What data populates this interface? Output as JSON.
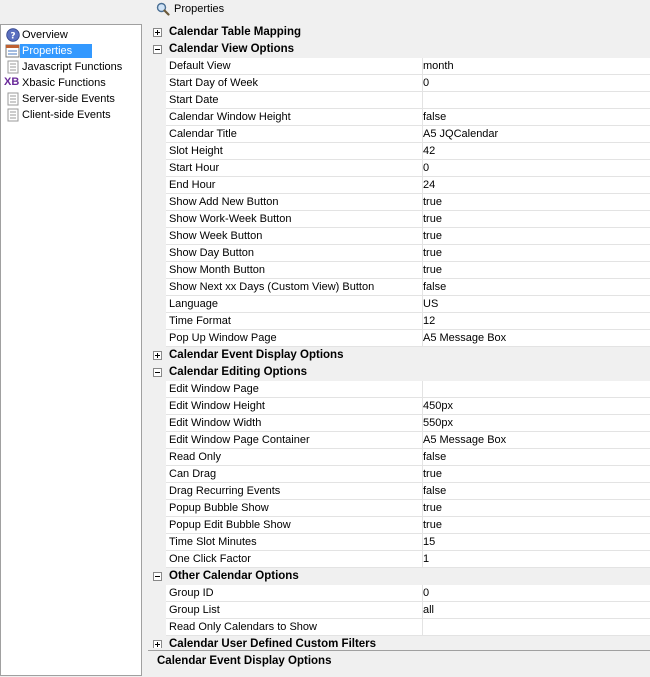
{
  "header": {
    "title": "Properties",
    "icon": "search-icon"
  },
  "sidebar": {
    "items": [
      {
        "label": "Overview",
        "icon": "overview-icon",
        "selected": false
      },
      {
        "label": "Properties",
        "icon": "properties-icon",
        "selected": true
      },
      {
        "label": "Javascript Functions",
        "icon": "javascript-icon",
        "selected": false
      },
      {
        "label": "Xbasic Functions",
        "icon": "xbasic-icon",
        "icon_text": "XB",
        "selected": false
      },
      {
        "label": "Server-side Events",
        "icon": "server-events-icon",
        "selected": false
      },
      {
        "label": "Client-side Events",
        "icon": "client-events-icon",
        "selected": false
      }
    ]
  },
  "grid": {
    "rows": [
      {
        "type": "category",
        "label": "Calendar Table Mapping",
        "expanded": false
      },
      {
        "type": "category",
        "label": "Calendar View Options",
        "expanded": true
      },
      {
        "type": "prop",
        "name": "Default View",
        "value": "month"
      },
      {
        "type": "prop",
        "name": "Start Day of Week",
        "value": "0"
      },
      {
        "type": "prop",
        "name": "Start Date",
        "value": ""
      },
      {
        "type": "prop",
        "name": "Calendar Window Height",
        "value": "false"
      },
      {
        "type": "prop",
        "name": "Calendar Title",
        "value": "A5 JQCalendar"
      },
      {
        "type": "prop",
        "name": "Slot Height",
        "value": "42"
      },
      {
        "type": "prop",
        "name": "Start Hour",
        "value": "0"
      },
      {
        "type": "prop",
        "name": "End Hour",
        "value": "24"
      },
      {
        "type": "prop",
        "name": "Show Add New Button",
        "value": "true"
      },
      {
        "type": "prop",
        "name": "Show Work-Week Button",
        "value": "true"
      },
      {
        "type": "prop",
        "name": "Show Week Button",
        "value": "true"
      },
      {
        "type": "prop",
        "name": "Show Day Button",
        "value": "true"
      },
      {
        "type": "prop",
        "name": "Show Month Button",
        "value": "true"
      },
      {
        "type": "prop",
        "name": "Show Next xx Days (Custom View) Button",
        "value": "false"
      },
      {
        "type": "prop",
        "name": "Language",
        "value": "US"
      },
      {
        "type": "prop",
        "name": "Time Format",
        "value": "12"
      },
      {
        "type": "prop",
        "name": "Pop Up Window Page",
        "value": "A5 Message Box"
      },
      {
        "type": "category",
        "label": "Calendar Event Display Options",
        "expanded": false
      },
      {
        "type": "category",
        "label": "Calendar Editing Options",
        "expanded": true
      },
      {
        "type": "prop",
        "name": "Edit Window Page",
        "value": ""
      },
      {
        "type": "prop",
        "name": "Edit Window Height",
        "value": "450px"
      },
      {
        "type": "prop",
        "name": "Edit Window Width",
        "value": "550px"
      },
      {
        "type": "prop",
        "name": "Edit Window Page Container",
        "value": "A5 Message Box"
      },
      {
        "type": "prop",
        "name": "Read Only",
        "value": "false"
      },
      {
        "type": "prop",
        "name": "Can Drag",
        "value": "true"
      },
      {
        "type": "prop",
        "name": "Drag Recurring Events",
        "value": "false"
      },
      {
        "type": "prop",
        "name": "Popup Bubble Show",
        "value": "true"
      },
      {
        "type": "prop",
        "name": "Popup Edit Bubble Show",
        "value": "true"
      },
      {
        "type": "prop",
        "name": "Time Slot Minutes",
        "value": "15"
      },
      {
        "type": "prop",
        "name": "One Click Factor",
        "value": "1"
      },
      {
        "type": "category",
        "label": "Other Calendar Options",
        "expanded": true
      },
      {
        "type": "prop",
        "name": "Group ID",
        "value": "0"
      },
      {
        "type": "prop",
        "name": "Group List",
        "value": "all"
      },
      {
        "type": "prop",
        "name": "Read Only Calendars to Show",
        "value": ""
      },
      {
        "type": "category",
        "label": "Calendar User Defined Custom Filters",
        "expanded": false
      }
    ]
  },
  "description": {
    "title": "Calendar Event Display Options"
  },
  "colors": {
    "selection": "#3399ff",
    "panel_bg": "#f0f0f0",
    "grid_line": "#e3e3e3"
  }
}
